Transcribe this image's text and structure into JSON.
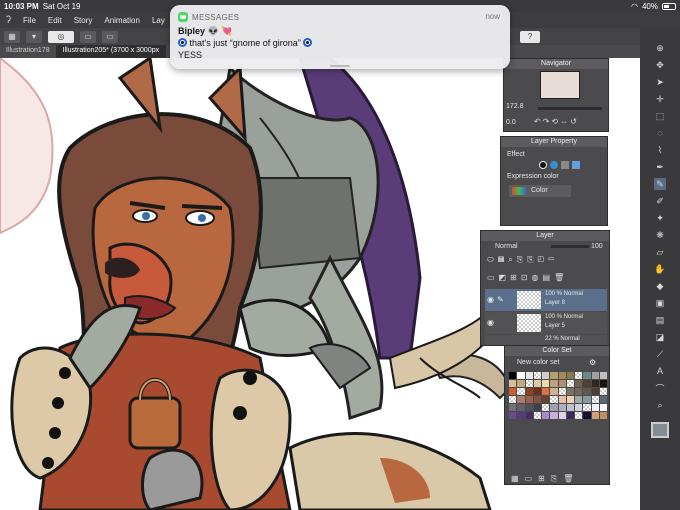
{
  "statusbar": {
    "time": "10:03 PM",
    "date": "Sat Oct 19",
    "battery": "40%"
  },
  "menubar": {
    "items": [
      "File",
      "Edit",
      "Story",
      "Animation",
      "Lay"
    ]
  },
  "tabs": [
    {
      "label": "Illustration178"
    },
    {
      "label": "Illustration205* (3700 x 3000px"
    }
  ],
  "notification": {
    "app": "MESSAGES",
    "time": "now",
    "sender": "Bipley",
    "line1": "that's just “gnome of girona”",
    "line2": "YESS"
  },
  "navigator": {
    "title": "Navigator",
    "zoom": "172.8",
    "rotation": "0.0"
  },
  "layer_property": {
    "title": "Layer Property",
    "effect_label": "Effect",
    "expression_label": "Expression color",
    "expression_value": "Color"
  },
  "layer_panel": {
    "title": "Layer",
    "blend_mode": "Normal",
    "opacity": "100",
    "layers": [
      {
        "info": "100 % Normal",
        "name": "Layer 8"
      },
      {
        "info": "100 % Normal",
        "name": "Layer 5"
      },
      {
        "info": "22 % Normal",
        "name": ""
      }
    ]
  },
  "color_set": {
    "title": "Color Set",
    "set_name": "New color set"
  },
  "colors": {
    "palette_row1": [
      "#000000",
      "#ffffff",
      "#e8e8e8",
      "#f2f2f2",
      "#cfcfcf",
      "#b8a06a",
      "#a08c5a",
      "#8a7a4f",
      "#7a9a8a",
      "#6a8a8a",
      "#a0a0a0",
      "#c0c0c0"
    ],
    "palette_row2": [
      "#d8c090",
      "#c8a878",
      "#b89060",
      "#e0c8a0",
      "#f0d8b0",
      "#c0a080",
      "#b09070",
      "#908060",
      "#706050",
      "#504030",
      "#302820",
      "#181410"
    ],
    "palette_row3": [
      "#c86030",
      "#b05028",
      "#904020",
      "#703018",
      "#e07040",
      "#d0b090",
      "#a09080",
      "#807060",
      "#706858",
      "#605850",
      "#484038",
      "#383028"
    ],
    "palette_row4": [
      "#c89080",
      "#b07868",
      "#986050",
      "#805040",
      "#684030",
      "#d0a890",
      "#e8c0a8",
      "#f0d0b8",
      "#a0a8a8",
      "#8898a0",
      "#708088",
      "#586870"
    ],
    "palette_row5": [
      "#707078",
      "#606068",
      "#505058",
      "#404048",
      "#9090a0",
      "#a0a0b0",
      "#b0b0c0",
      "#c0c0d0",
      "#d0d0e0",
      "#e0e0f0",
      "#f0f0ff",
      "#ffffff"
    ],
    "palette_row6": [
      "#6a4a8a",
      "#5a3a7a",
      "#4a2a6a",
      "#8a6aaa",
      "#aa8aca",
      "#c8b0d8",
      "#e0d0e8",
      "#3a2a5a",
      "#2a1a4a",
      "#1a0a3a",
      "#d0a070",
      "#c09060"
    ]
  }
}
